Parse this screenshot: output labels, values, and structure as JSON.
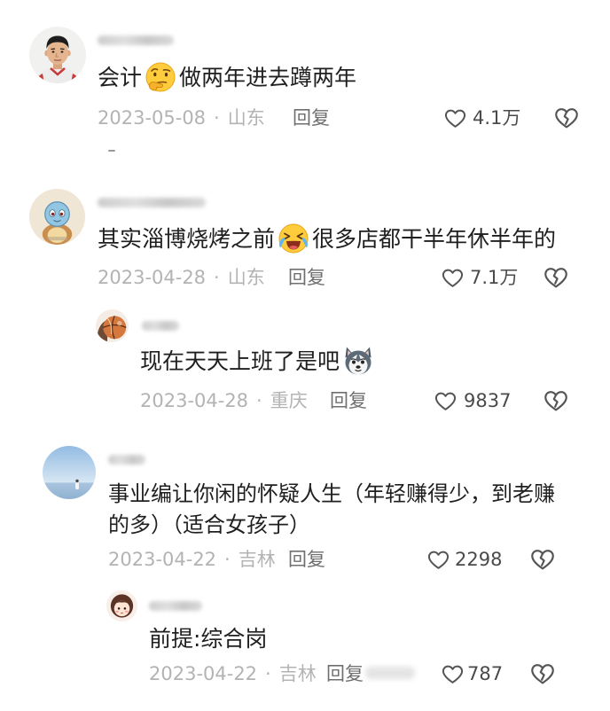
{
  "colors": {
    "background": "#ffffff",
    "text": "#1f1f1f",
    "meta": "#b3b3b3",
    "reply": "#6f6f6f",
    "count": "#4a4a4a",
    "icon": "#555555"
  },
  "icons": {
    "like": "heart-outline-icon",
    "dislike": "broken-heart-icon"
  },
  "meta_separator": "·",
  "comments": [
    {
      "text_before": "会计",
      "emoji": "thinking-face-icon",
      "text_after": "做两年进去蹲两年",
      "date": "2023-05-08",
      "location": "山东",
      "reply_label": "回复",
      "likes": "4.1万"
    },
    {
      "text_before": "其实淄博烧烤之前",
      "emoji": "crying-face-icon",
      "text_after": "很多店都干半年休半年的",
      "date": "2023-04-28",
      "location": "山东",
      "reply_label": "回复",
      "likes": "7.1万",
      "replies": [
        {
          "text_before": "现在天天上班了是吧",
          "emoji": "husky-dog-icon",
          "date": "2023-04-28",
          "location": "重庆",
          "reply_label": "回复",
          "likes": "9837"
        }
      ]
    },
    {
      "text": "事业编让你闲的怀疑人生（年轻赚得少，到老赚的多）（适合女孩子）",
      "date": "2023-04-22",
      "location": "吉林",
      "reply_label": "回复",
      "likes": "2298",
      "replies": [
        {
          "text": "前提:综合岗",
          "date": "2023-04-22",
          "location": "吉林",
          "reply_label": "回复",
          "likes": "787"
        }
      ]
    }
  ]
}
